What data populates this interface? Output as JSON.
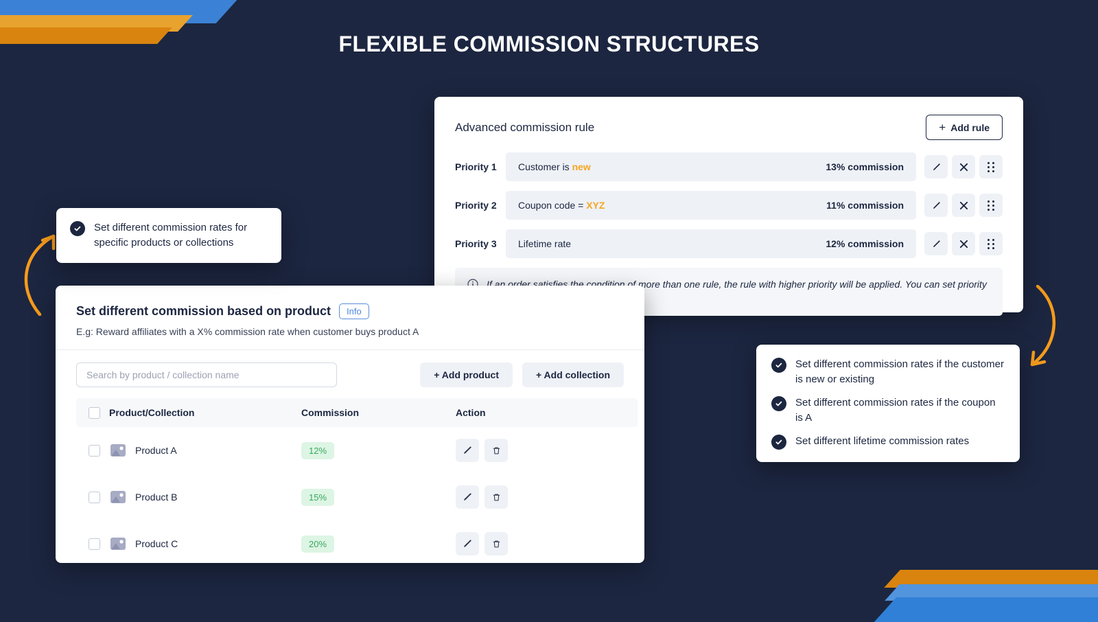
{
  "page": {
    "title": "FLEXIBLE COMMISSION STRUCTURES",
    "background_color": "#1c2640",
    "accent_orange": "#f5a623",
    "accent_blue": "#3b82d6"
  },
  "advanced_panel": {
    "title": "Advanced commission rule",
    "add_rule_label": "Add rule",
    "add_rule_plus": "+",
    "rules": [
      {
        "priority_label": "Priority 1",
        "condition_prefix": "Customer is ",
        "condition_highlight": "new",
        "commission": "13% commission",
        "edit_icon": "pencil-icon",
        "delete_icon": "close-x-icon",
        "drag_icon": "drag-handle-icon"
      },
      {
        "priority_label": "Priority 2",
        "condition_prefix": "Coupon code = ",
        "condition_highlight": "XYZ",
        "commission": "11% commission",
        "edit_icon": "pencil-icon",
        "delete_icon": "close-x-icon",
        "drag_icon": "drag-handle-icon"
      },
      {
        "priority_label": "Priority 3",
        "condition_prefix": "Lifetime rate",
        "condition_highlight": "",
        "commission": "12% commission",
        "edit_icon": "pencil-icon",
        "delete_icon": "close-x-icon",
        "drag_icon": "drag-handle-icon"
      }
    ],
    "note": "If an order satisfies the condition of more than one rule, the rule with higher priority will be applied. You can set priority by re-arrange the order above.",
    "note_icon": "info-circle-icon"
  },
  "product_panel": {
    "title": "Set different commission based on product",
    "info_badge": "Info",
    "subtitle": "E.g: Reward affiliates with a X% commission rate when customer buys product A",
    "search_placeholder": "Search by product / collection name",
    "search_value": "",
    "add_product_label": "+ Add product",
    "add_collection_label": "+ Add collection",
    "columns": [
      "Product/Collection",
      "Commission",
      "Action"
    ],
    "rows": [
      {
        "name": "Product A",
        "commission": "12%",
        "thumb_icon": "image-placeholder-icon",
        "edit_icon": "pencil-icon",
        "delete_icon": "trash-icon"
      },
      {
        "name": "Product B",
        "commission": "15%",
        "thumb_icon": "image-placeholder-icon",
        "edit_icon": "pencil-icon",
        "delete_icon": "trash-icon"
      },
      {
        "name": "Product C",
        "commission": "20%",
        "thumb_icon": "image-placeholder-icon",
        "edit_icon": "pencil-icon",
        "delete_icon": "trash-icon"
      }
    ]
  },
  "callout_left": {
    "items": [
      {
        "text": "Set different commission rates for specific products or collections",
        "icon": "check-circle-icon"
      }
    ]
  },
  "callout_right": {
    "items": [
      {
        "text": "Set different commission rates if the customer is new or existing",
        "icon": "check-circle-icon"
      },
      {
        "text": "Set different commission rates if the coupon is A",
        "icon": "check-circle-icon"
      },
      {
        "text": "Set different lifetime commission rates",
        "icon": "check-circle-icon"
      }
    ]
  }
}
